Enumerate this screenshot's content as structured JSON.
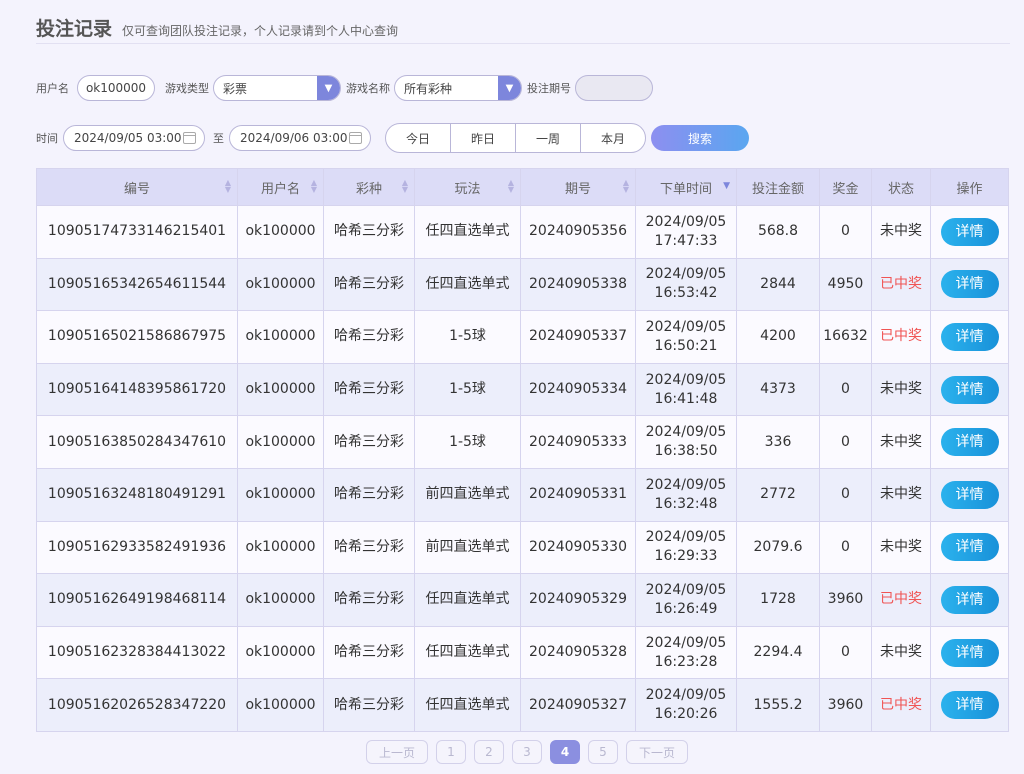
{
  "header": {
    "title": "投注记录",
    "subtitle": "仅可查询团队投注记录，个人记录请到个人中心查询"
  },
  "filters": {
    "username_label": "用户名",
    "username_value": "ok100000",
    "game_type_label": "游戏类型",
    "game_type_value": "彩票",
    "game_name_label": "游戏名称",
    "game_name_value": "所有彩种",
    "issue_label": "投注期号",
    "issue_value": "",
    "time_label": "时间",
    "start_time": "2024/09/05 03:00",
    "to_label": "至",
    "end_time": "2024/09/06 03:00",
    "quick_ranges": [
      "今日",
      "昨日",
      "一周",
      "本月"
    ],
    "search_label": "搜索"
  },
  "table": {
    "columns": [
      "编号",
      "用户名",
      "彩种",
      "玩法",
      "期号",
      "下单时间",
      "投注金额",
      "奖金",
      "状态",
      "操作"
    ],
    "detail_label": "详情",
    "rows": [
      {
        "id": "10905174733146215401",
        "user": "ok100000",
        "lottery": "哈希三分彩",
        "play": "任四直选单式",
        "issue": "20240905356",
        "date": "2024/09/05",
        "time": "17:47:33",
        "amount": "568.8",
        "prize": "0",
        "status": "未中奖",
        "won": false
      },
      {
        "id": "10905165342654611544",
        "user": "ok100000",
        "lottery": "哈希三分彩",
        "play": "任四直选单式",
        "issue": "20240905338",
        "date": "2024/09/05",
        "time": "16:53:42",
        "amount": "2844",
        "prize": "4950",
        "status": "已中奖",
        "won": true
      },
      {
        "id": "10905165021586867975",
        "user": "ok100000",
        "lottery": "哈希三分彩",
        "play": "1-5球",
        "issue": "20240905337",
        "date": "2024/09/05",
        "time": "16:50:21",
        "amount": "4200",
        "prize": "16632",
        "status": "已中奖",
        "won": true
      },
      {
        "id": "10905164148395861720",
        "user": "ok100000",
        "lottery": "哈希三分彩",
        "play": "1-5球",
        "issue": "20240905334",
        "date": "2024/09/05",
        "time": "16:41:48",
        "amount": "4373",
        "prize": "0",
        "status": "未中奖",
        "won": false
      },
      {
        "id": "10905163850284347610",
        "user": "ok100000",
        "lottery": "哈希三分彩",
        "play": "1-5球",
        "issue": "20240905333",
        "date": "2024/09/05",
        "time": "16:38:50",
        "amount": "336",
        "prize": "0",
        "status": "未中奖",
        "won": false
      },
      {
        "id": "10905163248180491291",
        "user": "ok100000",
        "lottery": "哈希三分彩",
        "play": "前四直选单式",
        "issue": "20240905331",
        "date": "2024/09/05",
        "time": "16:32:48",
        "amount": "2772",
        "prize": "0",
        "status": "未中奖",
        "won": false
      },
      {
        "id": "10905162933582491936",
        "user": "ok100000",
        "lottery": "哈希三分彩",
        "play": "前四直选单式",
        "issue": "20240905330",
        "date": "2024/09/05",
        "time": "16:29:33",
        "amount": "2079.6",
        "prize": "0",
        "status": "未中奖",
        "won": false
      },
      {
        "id": "10905162649198468114",
        "user": "ok100000",
        "lottery": "哈希三分彩",
        "play": "任四直选单式",
        "issue": "20240905329",
        "date": "2024/09/05",
        "time": "16:26:49",
        "amount": "1728",
        "prize": "3960",
        "status": "已中奖",
        "won": true
      },
      {
        "id": "10905162328384413022",
        "user": "ok100000",
        "lottery": "哈希三分彩",
        "play": "任四直选单式",
        "issue": "20240905328",
        "date": "2024/09/05",
        "time": "16:23:28",
        "amount": "2294.4",
        "prize": "0",
        "status": "未中奖",
        "won": false
      },
      {
        "id": "10905162026528347220",
        "user": "ok100000",
        "lottery": "哈希三分彩",
        "play": "任四直选单式",
        "issue": "20240905327",
        "date": "2024/09/05",
        "time": "16:20:26",
        "amount": "1555.2",
        "prize": "3960",
        "status": "已中奖",
        "won": true
      }
    ]
  },
  "pager": {
    "prev_label": "上一页",
    "next_label": "下一页",
    "pages": [
      "1",
      "2",
      "3",
      "4",
      "5"
    ],
    "current_page": "4"
  },
  "colors": {
    "accent": "#7d86dc",
    "won": "#f05454",
    "detail_button": "#1f9fe3"
  }
}
